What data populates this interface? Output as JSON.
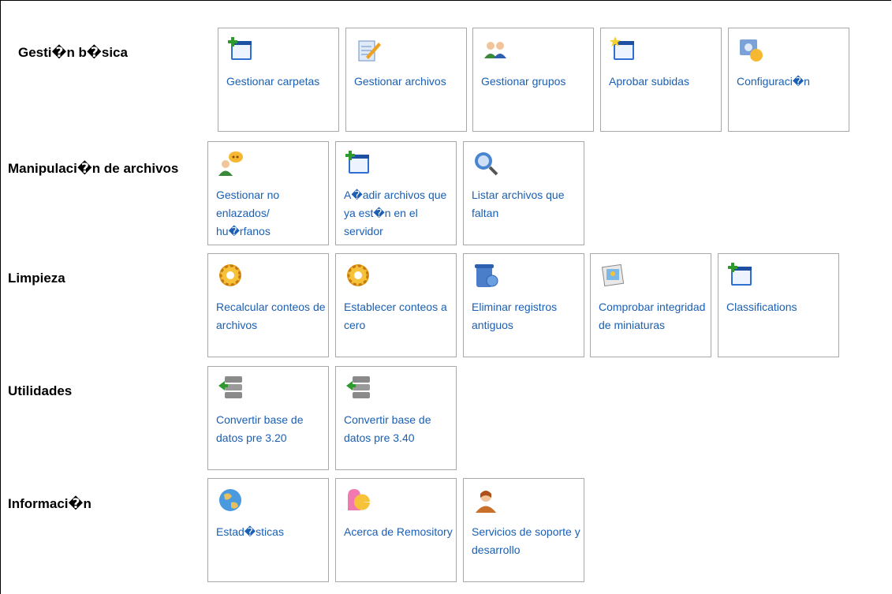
{
  "sections": [
    {
      "title": "Gesti�n b�sica"
    },
    {
      "title": "Manipulaci�n de archivos"
    },
    {
      "title": "Limpieza"
    },
    {
      "title": "Utilidades"
    },
    {
      "title": "Informaci�n"
    }
  ],
  "tiles": {
    "gestionar_carpetas": {
      "label": "Gestionar carpetas",
      "icon": "folder-add-icon"
    },
    "gestionar_archivos": {
      "label": "Gestionar archivos",
      "icon": "file-edit-icon"
    },
    "gestionar_grupos": {
      "label": "Gestionar grupos",
      "icon": "group-icon"
    },
    "aprobar_subidas": {
      "label": "Aprobar subidas",
      "icon": "folder-star-icon"
    },
    "configuracion": {
      "label": "Configuraci�n",
      "icon": "settings-icon"
    },
    "gestionar_no_enlazados": {
      "label": "Gestionar no enlazados/ hu�rfanos",
      "icon": "user-chat-icon"
    },
    "anadir_archivos": {
      "label": "A�adir archivos que ya est�n en el servidor",
      "icon": "folder-add-icon"
    },
    "listar_archivos": {
      "label": "Listar archivos que faltan",
      "icon": "magnifier-globe-icon"
    },
    "recalcular_conteos": {
      "label": "Recalcular conteos de archivos",
      "icon": "gear-icon"
    },
    "establecer_conteos": {
      "label": "Establecer conteos a cero",
      "icon": "gear-icon"
    },
    "eliminar_registros": {
      "label": "Eliminar registros antiguos",
      "icon": "recycle-bin-icon"
    },
    "comprobar_integridad": {
      "label": "Comprobar integridad de miniaturas",
      "icon": "image-icon"
    },
    "classifications": {
      "label": "Classifications",
      "icon": "folder-add-icon"
    },
    "convertir_320": {
      "label": "Convertir base de datos pre 3.20",
      "icon": "database-convert-icon"
    },
    "convertir_340": {
      "label": "Convertir base de datos pre 3.40",
      "icon": "database-convert-icon"
    },
    "estadisticas": {
      "label": "Estad�sticas",
      "icon": "globe-icon"
    },
    "acerca_de": {
      "label": "Acerca de Remository",
      "icon": "pacman-icon"
    },
    "servicios_soporte": {
      "label": "Servicios de soporte y desarrollo",
      "icon": "support-person-icon"
    }
  }
}
